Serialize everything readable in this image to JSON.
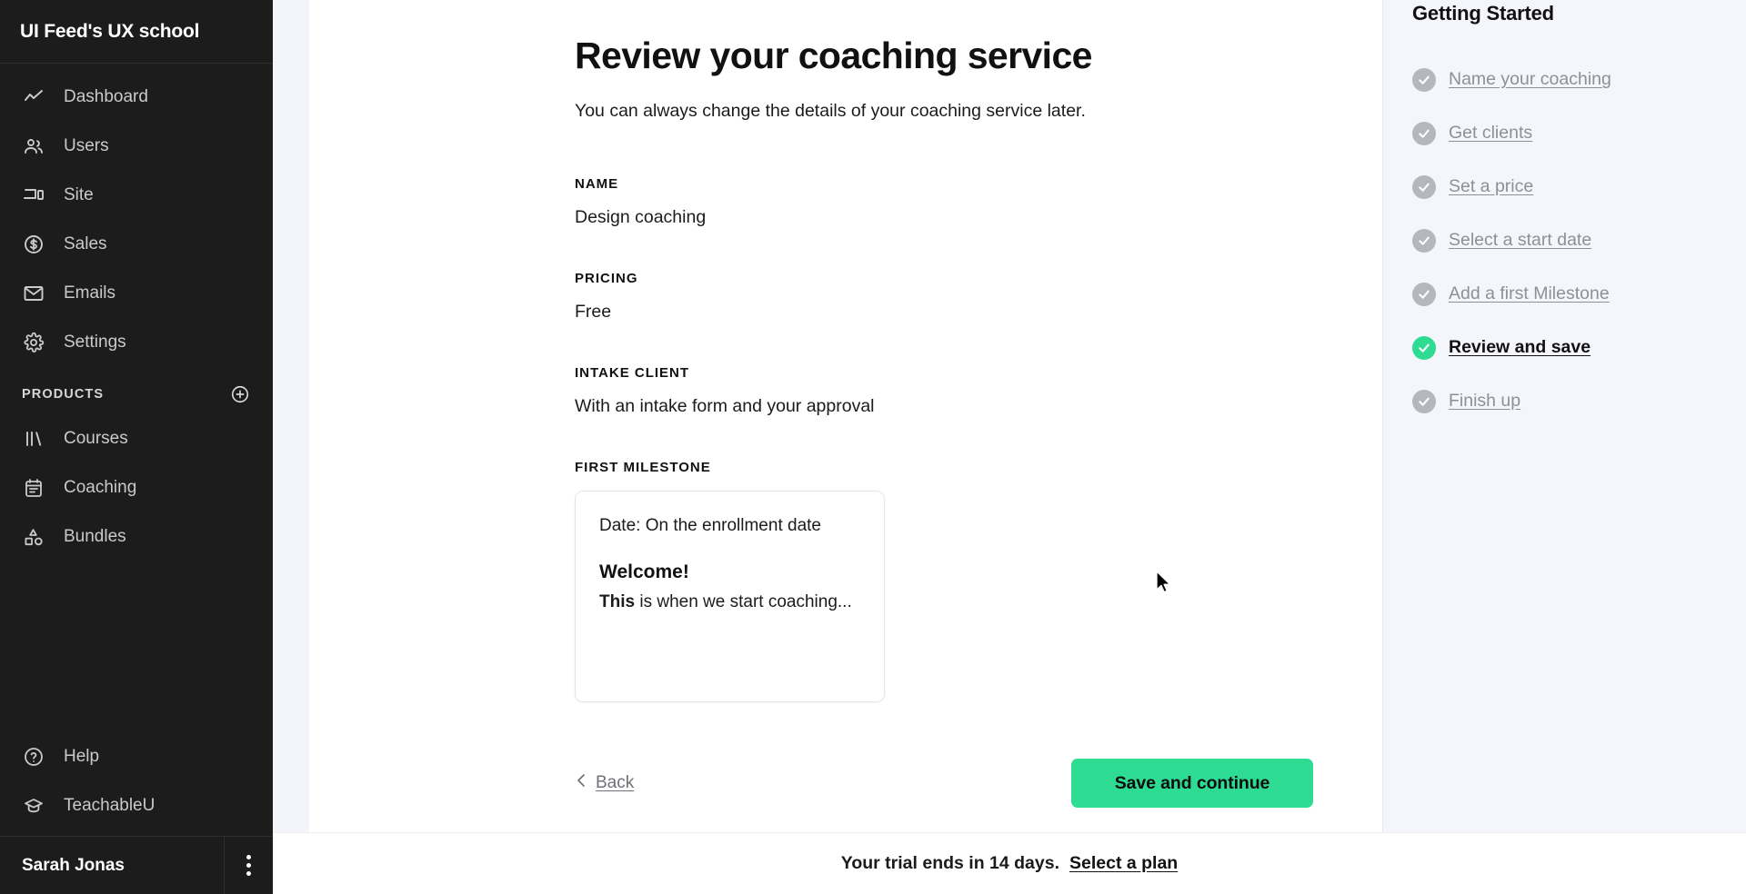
{
  "sidebar": {
    "brand": "UI Feed's UX school",
    "nav": [
      {
        "label": "Dashboard",
        "icon": "chart-line-icon"
      },
      {
        "label": "Users",
        "icon": "users-icon"
      },
      {
        "label": "Site",
        "icon": "devices-icon"
      },
      {
        "label": "Sales",
        "icon": "dollar-circle-icon"
      },
      {
        "label": "Emails",
        "icon": "envelope-icon"
      },
      {
        "label": "Settings",
        "icon": "gear-icon"
      }
    ],
    "products_header": "PRODUCTS",
    "products": [
      {
        "label": "Courses",
        "icon": "books-icon"
      },
      {
        "label": "Coaching",
        "icon": "calendar-icon"
      },
      {
        "label": "Bundles",
        "icon": "shapes-icon"
      }
    ],
    "bottom": [
      {
        "label": "Help",
        "icon": "question-circle-icon"
      },
      {
        "label": "TeachableU",
        "icon": "graduation-cap-icon"
      }
    ],
    "user_name": "Sarah Jonas"
  },
  "main": {
    "title": "Review your coaching service",
    "subtitle": "You can always change the details of your coaching service later.",
    "fields": [
      {
        "label": "NAME",
        "value": "Design coaching"
      },
      {
        "label": "PRICING",
        "value": "Free"
      },
      {
        "label": "INTAKE CLIENT",
        "value": "With an intake form and your approval"
      }
    ],
    "milestone_label": "FIRST MILESTONE",
    "milestone": {
      "date": "Date: On the enrollment date",
      "title": "Welcome!",
      "body_bold": "This",
      "body_rest": " is when we start coaching..."
    },
    "back_label": "Back",
    "save_label": "Save and continue"
  },
  "right_panel": {
    "title": "Getting Started",
    "items": [
      {
        "label": "Name your coaching",
        "state": "done"
      },
      {
        "label": "Get clients",
        "state": "done"
      },
      {
        "label": "Set a price",
        "state": "done"
      },
      {
        "label": "Select a start date",
        "state": "done"
      },
      {
        "label": "Add a first Milestone",
        "state": "done"
      },
      {
        "label": "Review and save",
        "state": "active"
      },
      {
        "label": "Finish up",
        "state": "done"
      }
    ]
  },
  "trial": {
    "text": "Your trial ends in 14 days.",
    "link": "Select a plan"
  },
  "colors": {
    "accent_green": "#2ddb93",
    "sidebar_bg": "#1c1c1c",
    "panel_bg": "#f4f6fb",
    "muted_text": "#8d9096"
  }
}
